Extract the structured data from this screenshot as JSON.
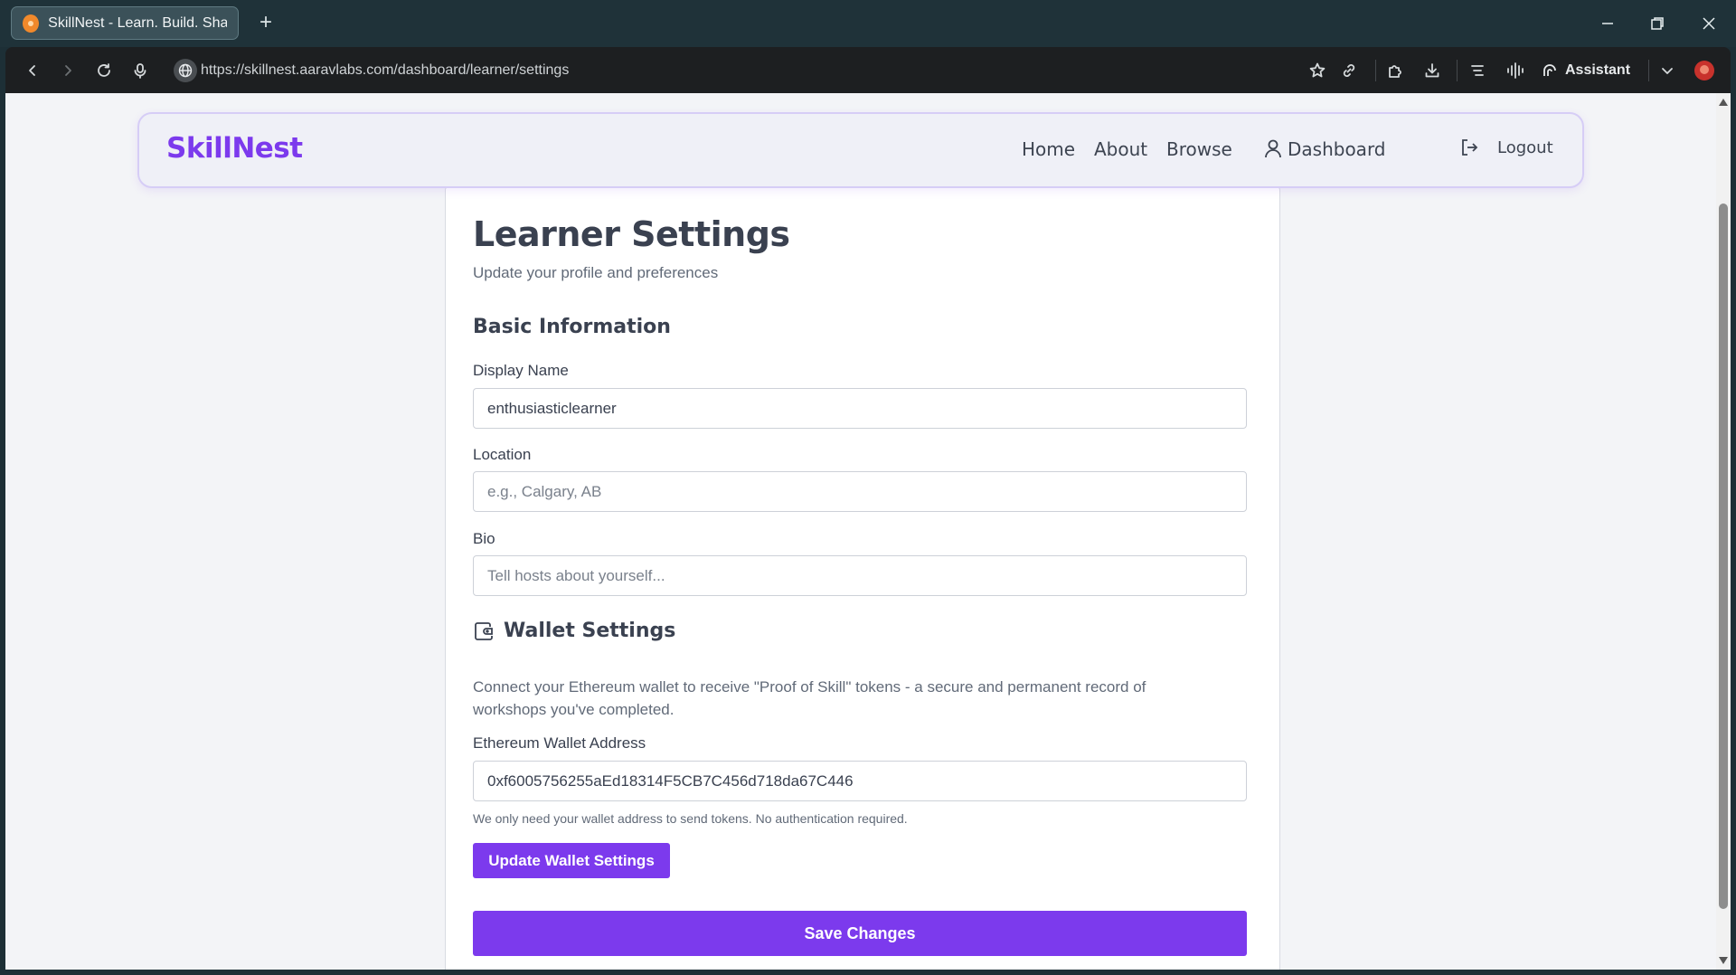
{
  "browser": {
    "tab_title": "SkillNest - Learn. Build. Share.",
    "new_tab_icon": "plus-icon",
    "url": "https://skillnest.aaravlabs.com/dashboard/learner/settings",
    "assistant_label": "Assistant"
  },
  "nav": {
    "logo": "SkillNest",
    "links": [
      "Home",
      "About",
      "Browse"
    ],
    "dashboard_label": "Dashboard",
    "logout_label": "Logout"
  },
  "settings": {
    "title": "Learner Settings",
    "subtitle": "Update your profile and preferences",
    "basic_section": {
      "title": "Basic Information",
      "display_name_label": "Display Name",
      "display_name_value": "enthusiasticlearner",
      "location_label": "Location",
      "location_placeholder": "e.g., Calgary, AB",
      "bio_label": "Bio",
      "bio_placeholder": "Tell hosts about yourself..."
    },
    "wallet_section": {
      "title": "Wallet Settings",
      "description": "Connect your Ethereum wallet to receive \"Proof of Skill\" tokens - a secure and permanent record of workshops you've completed.",
      "address_label": "Ethereum Wallet Address",
      "address_value": "0xf6005756255aEd18314F5CB7C456d718da67C446",
      "hint": "We only need your wallet address to send tokens. No authentication required.",
      "update_button": "Update Wallet Settings"
    },
    "save_button": "Save Changes"
  },
  "colors": {
    "brand": "#7c3aed",
    "text": "#3a4150",
    "muted": "#616a78"
  }
}
